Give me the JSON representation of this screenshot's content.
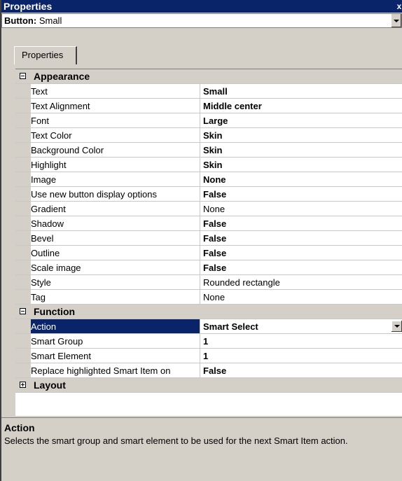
{
  "window": {
    "title": "Properties",
    "close_glyph": "x"
  },
  "object_selector": {
    "kind": "Button:",
    "name": "Small"
  },
  "tabs": [
    {
      "label": "Properties"
    }
  ],
  "categories": {
    "appearance": {
      "label": "Appearance",
      "toggle": "collapse"
    },
    "function": {
      "label": "Function",
      "toggle": "collapse"
    },
    "layout": {
      "label": "Layout",
      "toggle": "expand"
    }
  },
  "properties": {
    "appearance": [
      {
        "name": "Text",
        "value": "Small"
      },
      {
        "name": "Text Alignment",
        "value": "Middle center"
      },
      {
        "name": "Font",
        "value": "Large"
      },
      {
        "name": "Text Color",
        "value": "Skin"
      },
      {
        "name": "Background Color",
        "value": "Skin"
      },
      {
        "name": "Highlight",
        "value": "Skin"
      },
      {
        "name": "Image",
        "value": "None"
      },
      {
        "name": "Use new button display options",
        "value": "False"
      },
      {
        "name": "Gradient",
        "value": "None"
      },
      {
        "name": "Shadow",
        "value": "False"
      },
      {
        "name": "Bevel",
        "value": "False"
      },
      {
        "name": "Outline",
        "value": "False"
      },
      {
        "name": "Scale image",
        "value": "False"
      },
      {
        "name": "Style",
        "value": "Rounded rectangle"
      },
      {
        "name": "Tag",
        "value": "None"
      }
    ],
    "function": [
      {
        "name": "Action",
        "value": "Smart Select",
        "selected": true
      },
      {
        "name": "Smart Group",
        "value": "1"
      },
      {
        "name": "Smart Element",
        "value": "1"
      },
      {
        "name": "Replace highlighted Smart Item on",
        "value": "False"
      }
    ]
  },
  "help": {
    "title": "Action",
    "description": "Selects the smart group and smart element to be used for the next Smart Item action."
  },
  "colors": {
    "titlebar": "#0a246a",
    "selection": "#0a246a",
    "panel": "#d4d0c8"
  }
}
